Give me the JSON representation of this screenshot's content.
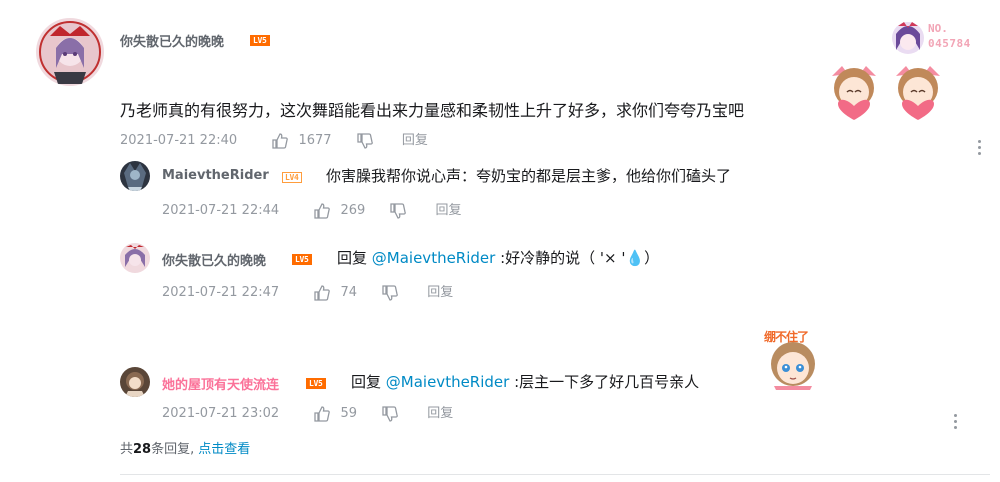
{
  "main_comment": {
    "username": "你失散已久的晚晚",
    "level": "LV5",
    "text": "乃老师真的有很努力，这次舞蹈能看出来力量感和柔韧性上升了好多，求你们夸夸乃宝吧",
    "time": "2021-07-21 22:40",
    "likes": "1677",
    "reply_label": "回复",
    "fan_badge_label": "NO.",
    "fan_badge_number": "045784"
  },
  "replies": [
    {
      "username": "MaievtheRider",
      "level": "LV4",
      "prefix": "",
      "mention": "",
      "text": "你害臊我帮你说心声：夸奶宝的都是层主爹，他给你们磕头了",
      "time": "2021-07-21 22:44",
      "likes": "269",
      "reply_label": "回复"
    },
    {
      "username": "你失散已久的晚晚",
      "level": "LV5",
      "prefix": "回复 ",
      "mention": "@MaievtheRider",
      "text": " :好冷静的说（ '× '💧）",
      "time": "2021-07-21 22:47",
      "likes": "74",
      "reply_label": "回复"
    },
    {
      "username": "她的屋顶有天使流连",
      "level": "LV5",
      "prefix": "回复 ",
      "mention": "@MaievtheRider",
      "text": " :层主一下多了好几百号亲人",
      "time": "2021-07-21 23:02",
      "likes": "59",
      "reply_label": "回复",
      "sticker_text": "绷不住了"
    }
  ],
  "summary": {
    "prefix": "共",
    "count": "28",
    "suffix": "条回复,",
    "link": "点击查看"
  },
  "icons": {
    "like": "thumbs-up-icon",
    "dislike": "thumbs-down-icon",
    "more": "more-vertical-icon"
  },
  "colors": {
    "link": "#008ac5",
    "meta": "#9499a0",
    "level": "#ff6c00",
    "pink_name": "#fb7299"
  }
}
